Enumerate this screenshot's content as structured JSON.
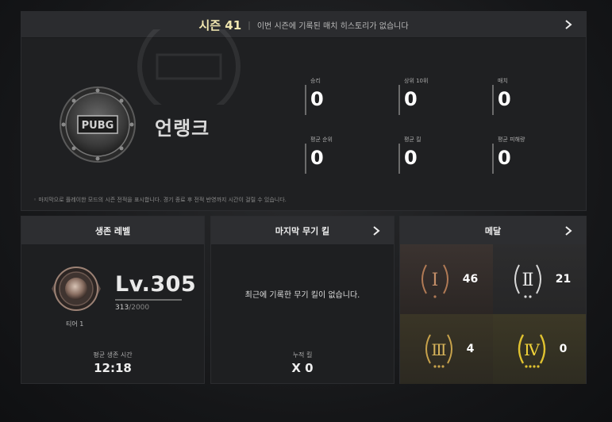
{
  "season": {
    "title": "시즌 41",
    "separator": "|",
    "message": "이번 시즌에 기록된 매치 히스토리가 없습니다"
  },
  "rank": {
    "name": "언랭크",
    "emblem_text": "PUBG"
  },
  "stats": [
    {
      "label": "승리",
      "value": "0"
    },
    {
      "label": "상위 10위",
      "value": "0"
    },
    {
      "label": "매치",
      "value": "0"
    },
    {
      "label": "평균 순위",
      "value": "0"
    },
    {
      "label": "평균 킬",
      "value": "0"
    },
    {
      "label": "평균 피해량",
      "value": "0"
    }
  ],
  "note": "마지막으로 플레이한 모드의 시즌 전적을 표시합니다. 경기 종료 후 전적 반영까지 시간이 걸릴 수 있습니다.",
  "survival": {
    "title": "생존 레벨",
    "level": "Lv.305",
    "xp_current": "313",
    "xp_max": "/2000",
    "tier": "티어 1",
    "avg_label": "평균 생존 시간",
    "avg_value": "12:18"
  },
  "weapon": {
    "title": "마지막 무기 킬",
    "empty": "최근에 기록한 무기 킬이 없습니다.",
    "total_label": "누적 킬",
    "total_value": "X 0"
  },
  "medals": {
    "title": "메달",
    "items": [
      {
        "numeral": "Ⅰ",
        "count": "46",
        "color": "#b07a55"
      },
      {
        "numeral": "Ⅱ",
        "count": "21",
        "color": "#d8d8d8"
      },
      {
        "numeral": "Ⅲ",
        "count": "4",
        "color": "#c7a24b"
      },
      {
        "numeral": "Ⅳ",
        "count": "0",
        "color": "#e0c230"
      }
    ]
  },
  "icons": {
    "chevron": "chevron-right-icon"
  }
}
